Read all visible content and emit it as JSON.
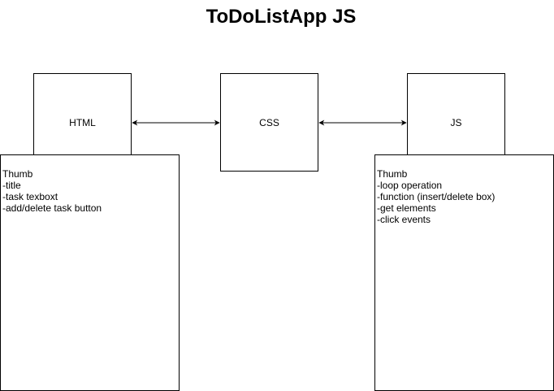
{
  "diagram": {
    "title": "ToDoListApp JS",
    "nodes": [
      {
        "id": "html",
        "label": "HTML"
      },
      {
        "id": "css",
        "label": "CSS"
      },
      {
        "id": "js",
        "label": "JS"
      }
    ],
    "edges": [
      {
        "from": "html",
        "to": "css",
        "direction": "both"
      },
      {
        "from": "css",
        "to": "js",
        "direction": "both"
      }
    ],
    "notes": {
      "html": {
        "heading": "Thumb",
        "items": [
          "-title",
          "-task texboxt",
          "-add/delete task button"
        ]
      },
      "js": {
        "heading": "Thumb",
        "items": [
          "-loop operation",
          "-function (insert/delete box)",
          "-get elements",
          "-click events"
        ]
      }
    }
  }
}
